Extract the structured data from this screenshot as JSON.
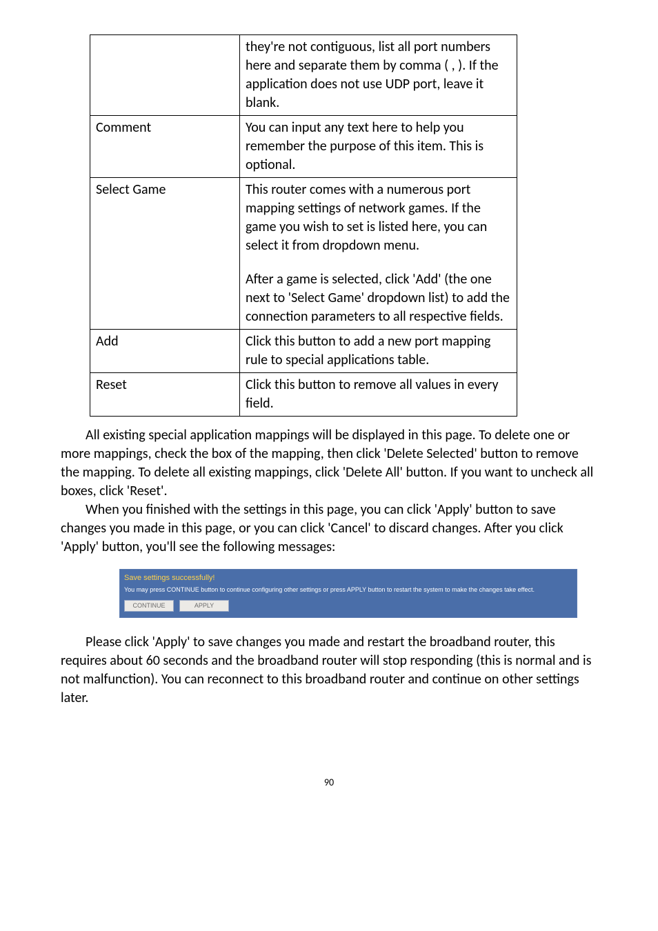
{
  "table": {
    "rows": [
      {
        "label": "",
        "desc": "they're not contiguous, list all port numbers here and separate them by comma ( , ). If the application does not use UDP port, leave it blank."
      },
      {
        "label": "Comment",
        "desc": "You can input any text here to help you remember the purpose of this item. This is optional."
      },
      {
        "label": "Select Game",
        "desc": "This router comes with a numerous port mapping settings of network games. If the game you wish to set is listed here, you can select it from dropdown menu.\n\nAfter a game is selected, click 'Add' (the one next to 'Select Game' dropdown list) to add the connection parameters to all respective fields."
      },
      {
        "label": "Add",
        "desc": "Click this button to add a new port mapping rule to special applications table."
      },
      {
        "label": "Reset",
        "desc": "Click this button to remove all values in every field."
      }
    ]
  },
  "paragraphs": {
    "p1": "All existing special application mappings will be displayed in this page. To delete one or more mappings, check the box of the mapping, then click 'Delete Selected' button to remove the mapping. To delete all existing mappings, click 'Delete All' button. If you want to uncheck all boxes, click 'Reset'.",
    "p2": "When you finished with the settings in this page, you can click 'Apply' button to save changes you made in this page, or you can click 'Cancel' to discard changes. After you click 'Apply' button, you'll see the following messages:",
    "p3": "Please click 'Apply' to save changes you made and restart the broadband router, this requires about 60 seconds and the broadband router will stop responding (this is normal and is not malfunction). You can reconnect to this broadband router and continue on other settings later."
  },
  "banner": {
    "title": "Save settings successfully!",
    "msg": "You may press CONTINUE button to continue configuring other settings or press APPLY button to restart the system to make the changes take effect.",
    "continue_label": "CONTINUE",
    "apply_label": "APPLY"
  },
  "page_number": "90"
}
